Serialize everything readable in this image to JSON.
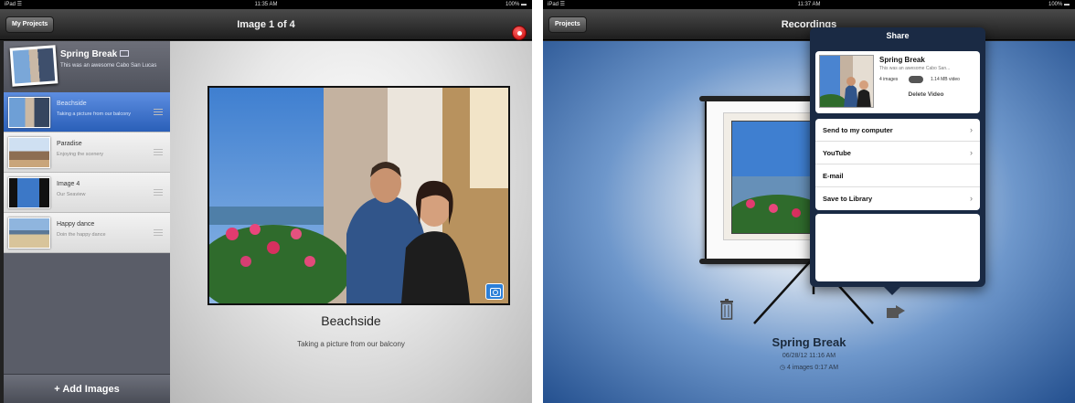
{
  "left": {
    "status": {
      "carrier": "iPad ☰",
      "time": "11:35 AM",
      "battery": "100% ▬"
    },
    "nav": {
      "projects_button": "My Projects",
      "title": "Image 1 of 4"
    },
    "project": {
      "title": "Spring Break",
      "description": "This was an awesome Cabo San Lucas"
    },
    "images": [
      {
        "name": "Beachside",
        "sub": "Taking a picture from our balcony",
        "selected": true
      },
      {
        "name": "Paradise",
        "sub": "Enjoying the scenery",
        "selected": false
      },
      {
        "name": "Image 4",
        "sub": "Our Seaview",
        "selected": false
      },
      {
        "name": "Happy dance",
        "sub": "Doin the happy dance",
        "selected": false
      }
    ],
    "add_images_label": "+ Add Images",
    "main": {
      "image_title": "Beachside",
      "image_caption": "Taking a picture from our balcony"
    }
  },
  "right": {
    "status": {
      "carrier": "iPad ☰",
      "time": "11:37 AM",
      "battery": "100% ▬"
    },
    "nav": {
      "projects_button": "Projects",
      "title": "Recordings"
    },
    "recording": {
      "title": "Spring Break",
      "date": "06/28/12 11:16 AM",
      "meta": "4 images  0:17 AM"
    },
    "share": {
      "header": "Share",
      "card_title": "Spring Break",
      "card_desc": "This was an awesome Cabo San...",
      "card_images": "4 images",
      "card_size": "1.14 MB video",
      "delete_label": "Delete Video",
      "items": [
        {
          "label": "Send to my computer",
          "chevron": "›"
        },
        {
          "label": "YouTube",
          "chevron": "›"
        },
        {
          "label": "E-mail",
          "chevron": ""
        },
        {
          "label": "Save to Library",
          "chevron": "›"
        }
      ]
    }
  },
  "colors": {
    "selection_blue": "#2a5fb8",
    "record_red": "#c40000",
    "popover_navy": "#1a2a44",
    "camera_blue": "#2c7fd8"
  },
  "icons": [
    "record-icon",
    "camera-icon",
    "film-icon",
    "grip-icon",
    "trash-icon",
    "share-icon",
    "chevron-right-icon",
    "clock-icon"
  ]
}
